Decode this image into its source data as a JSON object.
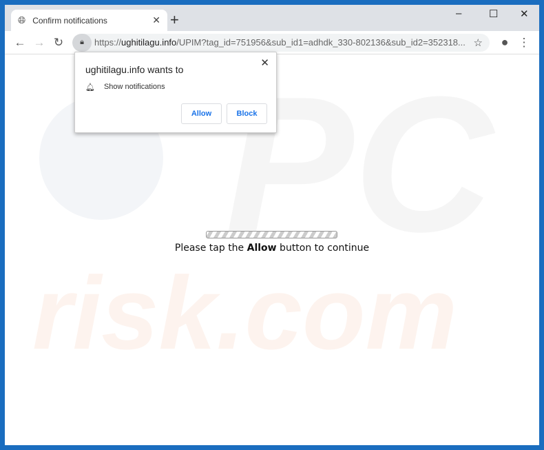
{
  "tab": {
    "title": "Confirm notifications",
    "icon": "globe-icon"
  },
  "window_controls": {
    "minimize": "–",
    "maximize": "☐",
    "close": "✕"
  },
  "omnibox": {
    "scheme": "https://",
    "host": "ughitilagu.info",
    "path": "/UPIM?tag_id=751956&sub_id1=adhdk_330-802136&sub_id2=352318..."
  },
  "popup": {
    "title": "ughitilagu.info wants to",
    "permission": "Show notifications",
    "allow": "Allow",
    "block": "Block"
  },
  "page": {
    "prefix": "Please tap the ",
    "bold": "Allow",
    "suffix": " button to continue"
  },
  "watermark": {
    "top": "PC",
    "bottom": "risk.com"
  }
}
